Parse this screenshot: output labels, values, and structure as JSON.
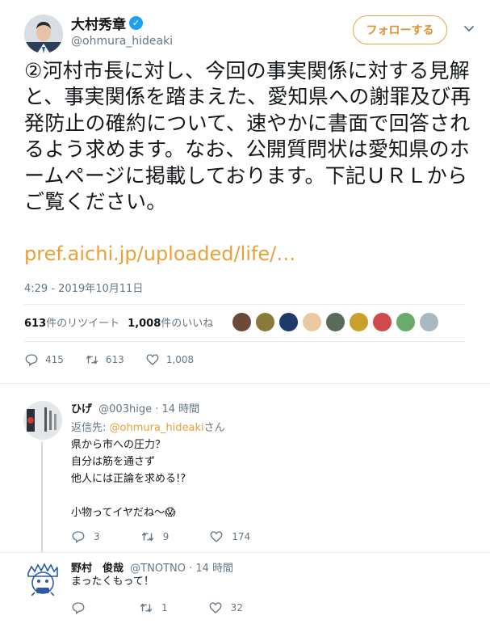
{
  "author": {
    "name": "大村秀章",
    "handle": "@ohmura_hideaki",
    "follow_label": "フォローする"
  },
  "tweet": {
    "text": "②河村市長に対し、今回の事実関係に対する見解と、事実関係を踏まえた、愛知県への謝罪及び再発防止の確約について、速やかに書面で回答されるよう求めます。なお、公開質問状は愛知県のホームページに掲載しております。下記ＵＲＬからご覧ください。",
    "link": "pref.aichi.jp/uploaded/life/…",
    "time": "4:29 - 2019年10月11日",
    "retweet_count": "613",
    "retweet_label": "件のリツイート",
    "like_count": "1,008",
    "like_label": "件のいいね",
    "actions": {
      "replies": "415",
      "retweets": "613",
      "likes": "1,008"
    }
  },
  "likers": [
    {
      "color": "#6b4a3a"
    },
    {
      "color": "#8a7a3a"
    },
    {
      "color": "#1f3a6a"
    },
    {
      "color": "#e8c9a0"
    },
    {
      "color": "#5a6a5a"
    },
    {
      "color": "#c9a12a"
    },
    {
      "color": "#d04a4a"
    },
    {
      "color": "#6aaa6a"
    },
    {
      "color": "#aab8c2"
    }
  ],
  "replies": [
    {
      "name": "ひげ",
      "handle": "@003hige",
      "time": "14 時間",
      "reply_to_prefix": "返信先: ",
      "reply_to_mention": "@ohmura_hideaki",
      "reply_to_suffix": "さん",
      "lines": [
        "県から市への圧力？",
        "自分は筋を通さず",
        "他人には正論を求める!?",
        "",
        "小物ってイヤだね〜😱"
      ],
      "replies": "3",
      "retweets": "9",
      "likes": "174"
    },
    {
      "name": "野村　俊哉",
      "handle": "@TNOTNO",
      "time": "14 時間",
      "lines": [
        "まったくもって！"
      ],
      "replies": "",
      "retweets": "1",
      "likes": "32"
    }
  ],
  "separator": "·"
}
